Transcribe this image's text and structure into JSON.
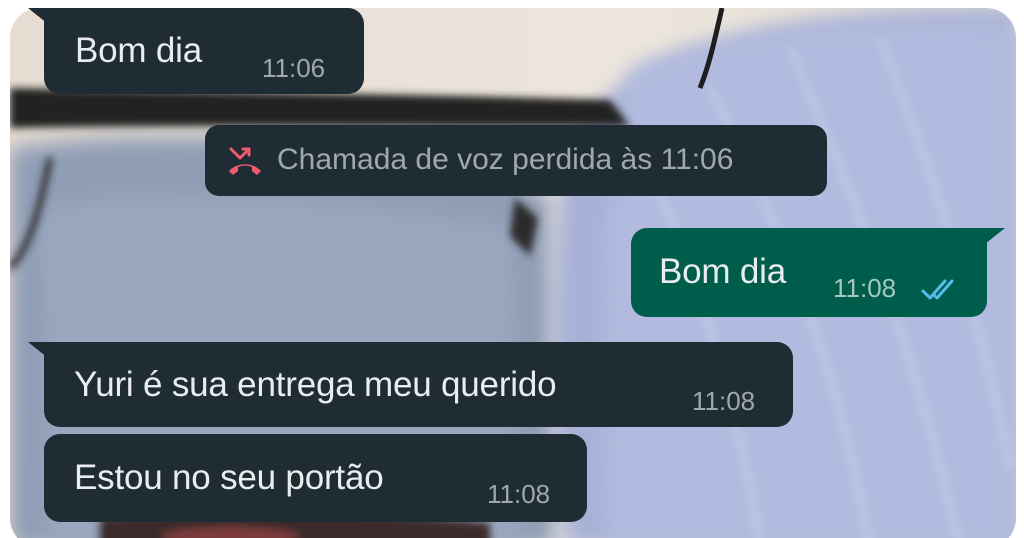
{
  "chat": {
    "messages": [
      {
        "direction": "incoming",
        "text": "Bom dia",
        "time": "11:06"
      },
      {
        "direction": "system",
        "text": "Chamada de voz perdida às 11:06",
        "icon": "missed-voice-call-icon"
      },
      {
        "direction": "outgoing",
        "text": "Bom dia",
        "time": "11:08",
        "status_icon": "double-check-read-icon"
      },
      {
        "direction": "incoming",
        "text": "Yuri é sua entrega meu querido",
        "time": "11:08"
      },
      {
        "direction": "incoming",
        "text": "Estou no seu portão",
        "time": "11:08"
      }
    ]
  },
  "colors": {
    "incoming_bubble": "#1f2c34",
    "outgoing_bubble": "#005c4b",
    "message_text": "#e9edef",
    "timestamp_text": "#9ea8ad",
    "missed_call_icon": "#f15c6d",
    "read_ticks": "#53bdeb"
  }
}
